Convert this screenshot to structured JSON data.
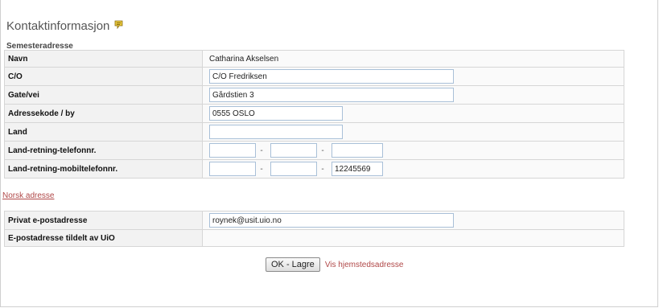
{
  "header": {
    "title": "Kontaktinformasjon",
    "help_icon": "help-speech-bubble-icon"
  },
  "semester": {
    "section_label": "Semesteradresse",
    "rows": {
      "navn": {
        "label": "Navn",
        "value": "Catharina Akselsen"
      },
      "co": {
        "label": "C/O",
        "value": "C/O Fredriksen"
      },
      "gate": {
        "label": "Gate/vei",
        "value": "Gårdstien 3"
      },
      "adressekode": {
        "label": "Adressekode / by",
        "value": "0555 OSLO"
      },
      "land": {
        "label": "Land",
        "value": ""
      },
      "telefon": {
        "label": "Land-retning-telefonnr.",
        "land": "",
        "retning": "",
        "nummer": ""
      },
      "mobil": {
        "label": "Land-retning-mobiltelefonnr.",
        "land": "",
        "retning": "",
        "nummer": "12245569"
      }
    },
    "separator": "-"
  },
  "norsk_adresse_link": "Norsk adresse",
  "email": {
    "privat": {
      "label": "Privat e-postadresse",
      "value": "roynek@usit.uio.no"
    },
    "uio": {
      "label": "E-postadresse tildelt av UiO",
      "value": ""
    }
  },
  "actions": {
    "save_label": "OK - Lagre",
    "hometown_link": "Vis hjemstedsadresse"
  },
  "colors": {
    "link": "#b04848",
    "label_bg": "#f2f2f2",
    "input_border": "#a9c0d8"
  }
}
